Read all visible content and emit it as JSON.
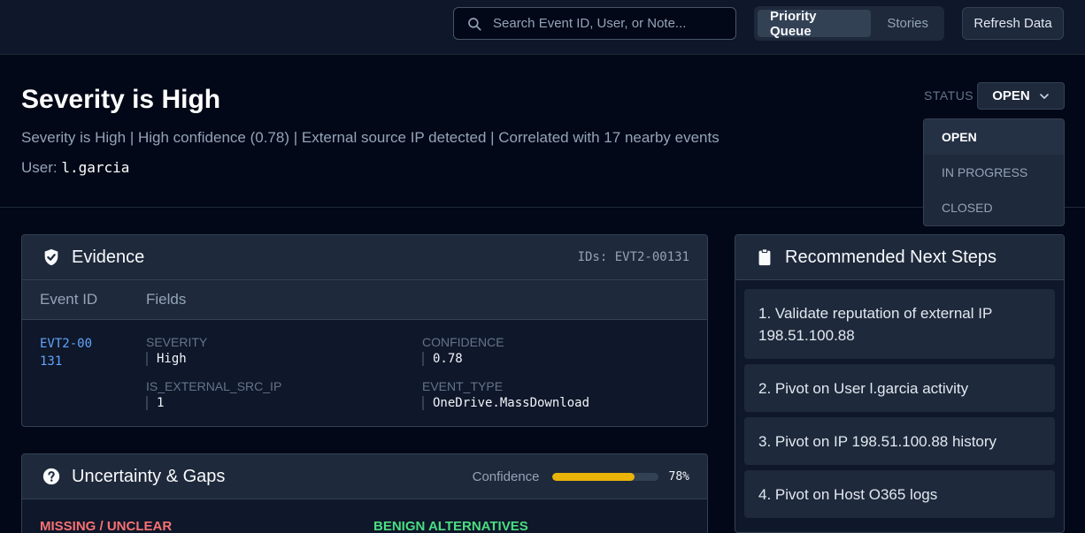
{
  "topbar": {
    "search_placeholder": "Search Event ID, User, or Note...",
    "tabs": [
      {
        "label": "Priority Queue",
        "active": true
      },
      {
        "label": "Stories",
        "active": false
      }
    ],
    "refresh_label": "Refresh Data"
  },
  "header": {
    "title": "Severity is High",
    "summary": "Severity is High | High confidence (0.78) | External source IP detected | Correlated with 17 nearby events",
    "user_label": "User:",
    "user_value": "l.garcia",
    "status_label": "STATUS",
    "status_value": "OPEN",
    "status_options": [
      "OPEN",
      "IN PROGRESS",
      "CLOSED"
    ]
  },
  "evidence": {
    "title": "Evidence",
    "ids": "IDs: EVT2-00131",
    "columns": [
      "Event ID",
      "Fields"
    ],
    "row": {
      "event_id": "EVT2-00131",
      "fields": [
        {
          "key": "SEVERITY",
          "value": "High"
        },
        {
          "key": "CONFIDENCE",
          "value": "0.78"
        },
        {
          "key": "IS_EXTERNAL_SRC_IP",
          "value": "1"
        },
        {
          "key": "EVENT_TYPE",
          "value": "OneDrive.MassDownload"
        }
      ]
    }
  },
  "uncertainty": {
    "title": "Uncertainty & Gaps",
    "confidence_label": "Confidence",
    "confidence_fraction": 0.78,
    "confidence_text": "78%",
    "missing_label": "MISSING / UNCLEAR",
    "benign_label": "BENIGN ALTERNATIVES"
  },
  "next_steps": {
    "title": "Recommended Next Steps",
    "items": [
      "1. Validate reputation of external IP 198.51.100.88",
      "2. Pivot on User l.garcia activity",
      "3. Pivot on IP 198.51.100.88 history",
      "4. Pivot on Host O365 logs"
    ]
  },
  "colors": {
    "background": "#020817",
    "accent_link": "#60a5fa",
    "confidence_bar": "#eab308",
    "missing": "#f87171",
    "benign": "#4ade80"
  }
}
